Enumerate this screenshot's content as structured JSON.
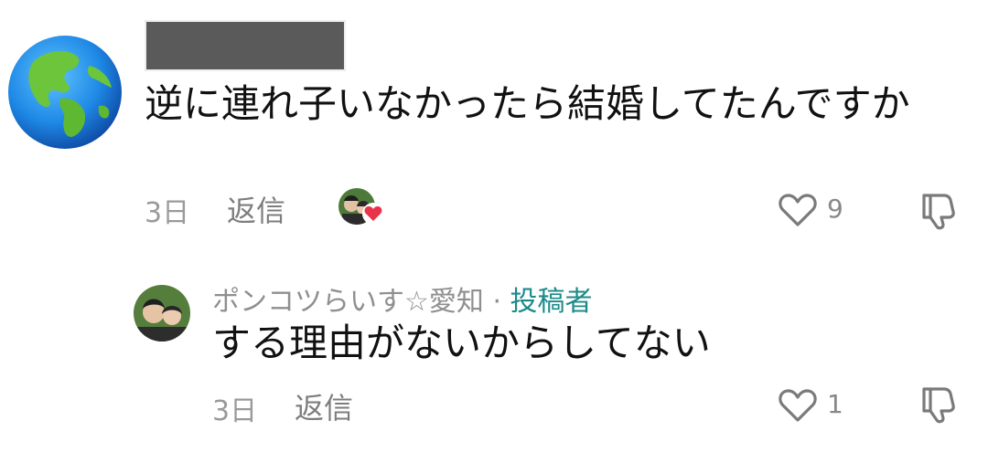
{
  "comment": {
    "text": "逆に連れ子いなかったら結婚してたんですか",
    "time": "3日",
    "reply_label": "返信",
    "like_count": "9",
    "icons": {
      "avatar": "globe-icon",
      "creator_liked": "creator-liked-avatar",
      "like": "heart-outline-icon",
      "dislike": "thumbs-down-icon"
    }
  },
  "reply": {
    "username": "ポンコツらいす☆愛知",
    "separator": " · ",
    "author_badge": "投稿者",
    "text": "する理由がないからしてない",
    "time": "3日",
    "reply_label": "返信",
    "like_count": "1"
  },
  "colors": {
    "author_badge": "#1d8a8a",
    "heart_badge": "#e8334b",
    "muted_text": "#9a9a9a"
  }
}
